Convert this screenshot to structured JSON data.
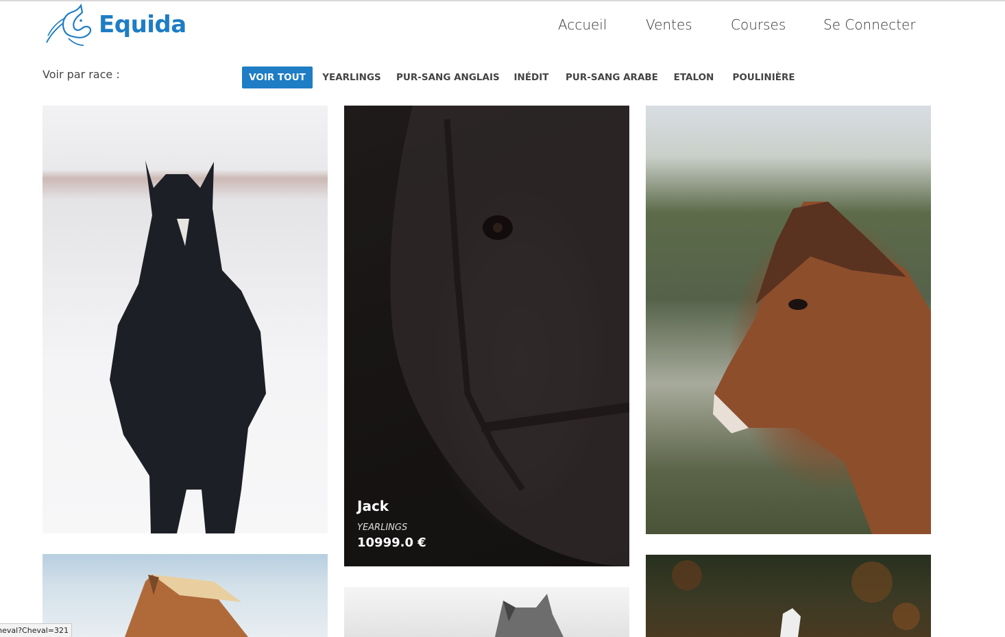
{
  "header": {
    "brand": "Equida",
    "nav": [
      "Accueil",
      "Ventes",
      "Courses",
      "Se Connecter"
    ]
  },
  "filters": {
    "label": "Voir par race :",
    "items": [
      "VOIR TOUT",
      "YEARLINGS",
      "PUR-SANG ANGLAIS",
      "INÉDIT",
      "PUR-SANG ARABE",
      "ETALON",
      "POULINIÈRE"
    ],
    "active": "VOIR TOUT"
  },
  "gallery": {
    "hovered_card": {
      "name": "Jack",
      "race": "YEARLINGS",
      "price": "10999.0 €"
    },
    "cards": [
      {
        "description": "black horse in snow"
      },
      {
        "description": "dark horse head close-up with bridle"
      },
      {
        "description": "brown horse head profile"
      },
      {
        "description": "chestnut horse with blond mane, sky"
      },
      {
        "description": "grey horse head, black and white"
      },
      {
        "description": "white horse in dark autumn forest"
      }
    ]
  },
  "status_bar": {
    "url": "heval?Cheval=321"
  },
  "colors": {
    "accent": "#1e7dc4"
  }
}
